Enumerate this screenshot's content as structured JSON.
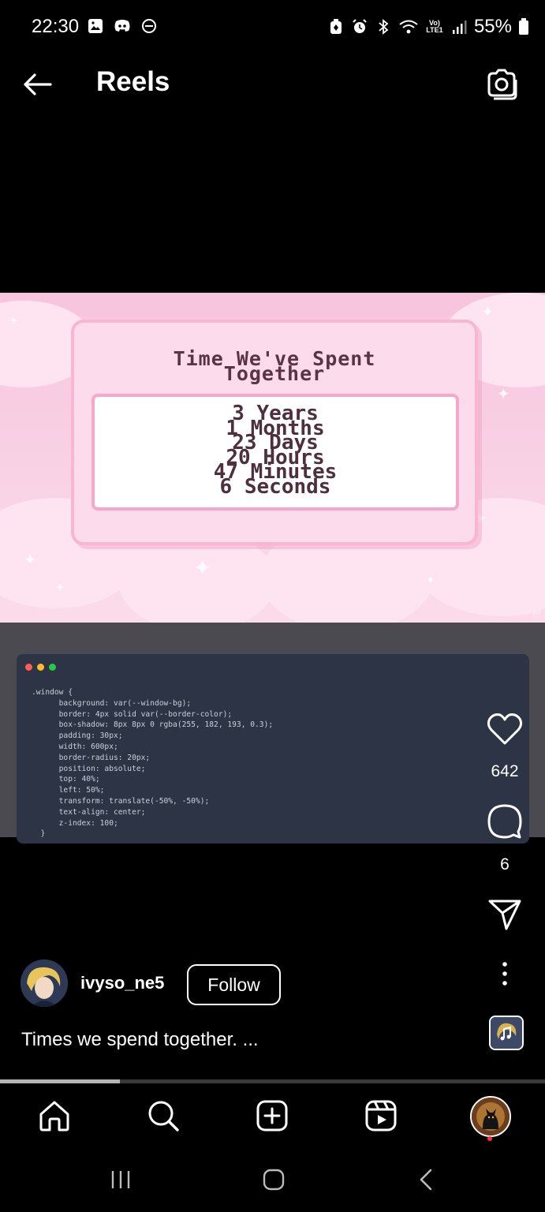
{
  "status_bar": {
    "time": "22:30",
    "battery": "55%",
    "left_icons": [
      "gallery-icon",
      "discord-icon",
      "dnd-icon"
    ],
    "right_icons": [
      "battery-saver-icon",
      "alarm-icon",
      "bluetooth-icon",
      "wifi-icon",
      "volte-icon",
      "signal-icon",
      "battery-icon"
    ]
  },
  "header": {
    "title": "Reels"
  },
  "video": {
    "window_title_line1": "Time We've Spent",
    "window_title_line2": "Together",
    "counter_lines": [
      "3 Years",
      "1 Months",
      "23 Days",
      "20 Hours",
      "47 Minutes",
      "6 Seconds"
    ],
    "watermark": "St-Sp",
    "code_lines": [
      ".window {",
      "      background: var(--window-bg);",
      "      border: 4px solid var(--border-color);",
      "      box-shadow: 8px 8px 0 rgba(255, 182, 193, 0.3);",
      "      padding: 30px;",
      "      width: 600px;",
      "      border-radius: 20px;",
      "      position: absolute;",
      "      top: 40%;",
      "      left: 50%;",
      "      transform: translate(-50%, -50%);",
      "      text-align: center;",
      "      z-index: 100;",
      "  }"
    ]
  },
  "actions": {
    "likes": "642",
    "comments": "6"
  },
  "post": {
    "username": "ivyso_ne5",
    "follow_label": "Follow",
    "caption": "Times we spend together. ..."
  },
  "playback": {
    "progress": 0.22
  },
  "colors": {
    "background": "#000000",
    "pink_bg": "#f9d3e6",
    "code_bg": "#2c3445",
    "notification_dot": "#ff3040"
  }
}
